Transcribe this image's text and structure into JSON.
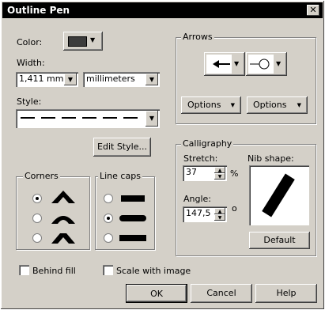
{
  "window": {
    "title": "Outline Pen",
    "close": "✕"
  },
  "color": {
    "label": "Color:",
    "value_hex": "#3c3c3c"
  },
  "width": {
    "label": "Width:",
    "value": "1,411 mm",
    "units": "millimeters"
  },
  "style": {
    "label": "Style:"
  },
  "edit_style": {
    "label": "Edit Style..."
  },
  "corners": {
    "title": "Corners",
    "selected": 0
  },
  "line_caps": {
    "title": "Line caps",
    "selected": 1
  },
  "arrows": {
    "title": "Arrows",
    "options_left": "Options",
    "options_right": "Options"
  },
  "calligraphy": {
    "title": "Calligraphy",
    "stretch_label": "Stretch:",
    "stretch_value": "37",
    "stretch_unit": "%",
    "angle_label": "Angle:",
    "angle_value": "147,5",
    "angle_unit": "o",
    "nib_label": "Nib shape:",
    "default_label": "Default"
  },
  "behind_fill": {
    "label": "Behind fill"
  },
  "scale_with_image": {
    "label": "Scale with image"
  },
  "buttons": {
    "ok": "OK",
    "cancel": "Cancel",
    "help": "Help"
  }
}
